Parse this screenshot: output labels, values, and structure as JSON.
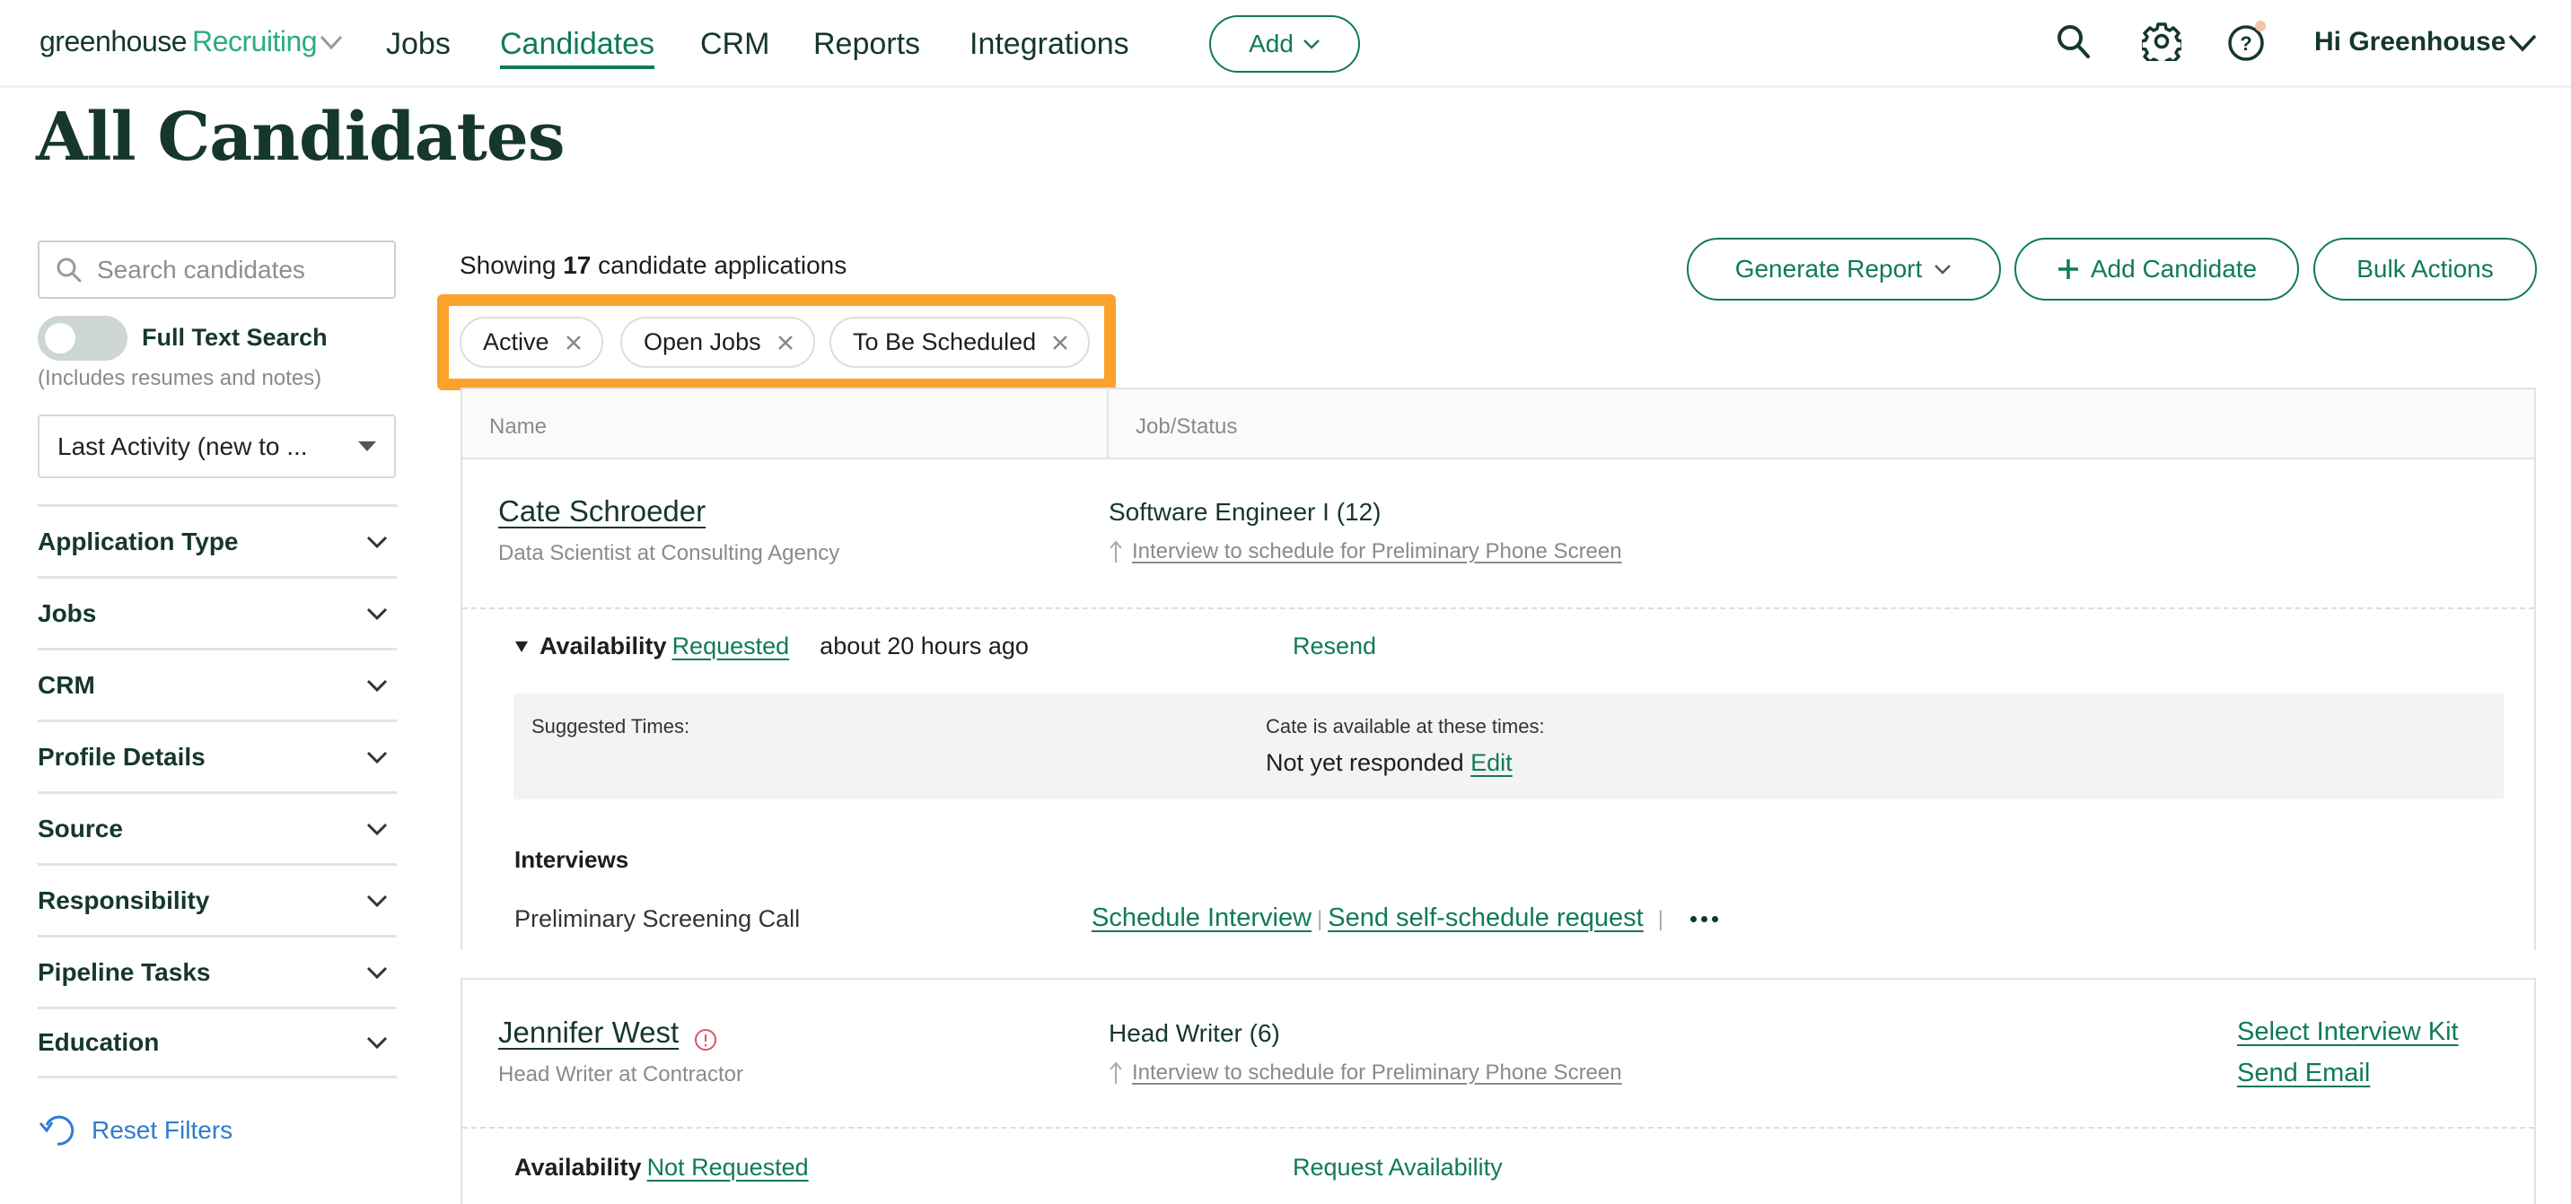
{
  "nav": {
    "logo_brand": "greenhouse",
    "logo_product": "Recruiting",
    "links": [
      "Jobs",
      "Candidates",
      "CRM",
      "Reports",
      "Integrations"
    ],
    "active_link": "Candidates",
    "add_label": "Add",
    "user_greeting": "Hi Greenhouse",
    "icons": [
      "search-icon",
      "gear-icon",
      "help-icon"
    ],
    "help_notification": true
  },
  "page": {
    "title": "All Candidates"
  },
  "sidebar": {
    "search_placeholder": "Search candidates",
    "search_value": "",
    "full_text_label": "Full Text Search",
    "full_text_enabled": false,
    "full_text_hint": "(Includes resumes and notes)",
    "sort_selected": "Last Activity (new to ...",
    "filters": [
      "Application Type",
      "Jobs",
      "CRM",
      "Profile Details",
      "Source",
      "Responsibility",
      "Pipeline Tasks",
      "Education"
    ],
    "reset_label": "Reset Filters"
  },
  "main": {
    "showing_prefix": "Showing",
    "showing_count": "17",
    "showing_suffix": "candidate applications",
    "active_filters": [
      "Active",
      "Open Jobs",
      "To Be Scheduled"
    ],
    "buttons": {
      "generate_report": "Generate Report",
      "add_candidate": "Add Candidate",
      "bulk_actions": "Bulk Actions"
    },
    "columns": [
      "Name",
      "Job/Status"
    ]
  },
  "candidates": [
    {
      "name": "Cate Schroeder",
      "subtitle": "Data Scientist at Consulting Agency",
      "job": "Software Engineer I (12)",
      "status": "Interview to schedule for Preliminary Phone Screen",
      "availability_label": "Availability",
      "availability_state": "Requested",
      "availability_time": "about 20 hours ago",
      "availability_action": "Resend",
      "suggested_times_label": "Suggested Times:",
      "available_label": "Cate is available at these times:",
      "available_value": "Not yet responded",
      "edit_label": "Edit",
      "interviews_label": "Interviews",
      "interview_name": "Preliminary Screening Call",
      "schedule_label": "Schedule Interview",
      "self_schedule_label": "Send self-schedule request"
    },
    {
      "name": "Jennifer West",
      "has_alert": true,
      "subtitle": "Head Writer at Contractor",
      "job": "Head Writer (6)",
      "status": "Interview to schedule for Preliminary Phone Screen",
      "action_1": "Select Interview Kit",
      "action_2": "Send Email",
      "availability_label": "Availability",
      "availability_state": "Not Requested",
      "availability_action": "Request Availability"
    }
  ],
  "colors": {
    "brand_dark": "#15372c",
    "accent_green": "#0f7a5b",
    "logo_green": "#2bab84",
    "highlight_orange": "#fba22c",
    "link_blue": "#2f7bd0",
    "alert_red": "#e0506a",
    "notification": "#f5c4ac"
  }
}
